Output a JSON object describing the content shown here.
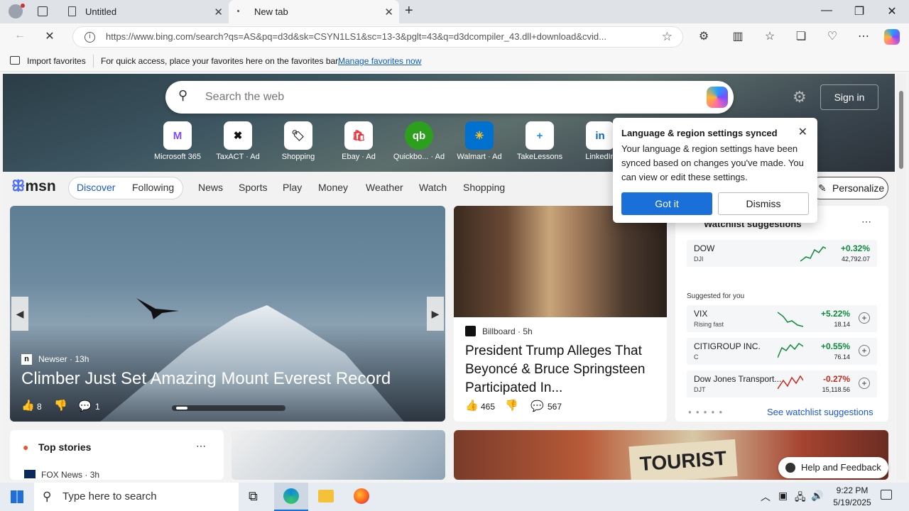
{
  "browser": {
    "tabs": [
      {
        "label": "Untitled"
      },
      {
        "label": "New tab"
      }
    ],
    "url": "https://www.bing.com/search?qs=AS&pq=d3d&sk=CSYN1LS1&sc=13-3&pglt=43&q=d3dcompiler_43.dll+download&cvid...",
    "favorites_bar": {
      "import": "Import favorites",
      "message": "For quick access, place your favorites here on the favorites bar.",
      "manage_link": "Manage favorites now"
    }
  },
  "hero": {
    "search_placeholder": "Search the web",
    "sign_in": "Sign in",
    "tiles": [
      {
        "label": "Microsoft 365",
        "icon": "M"
      },
      {
        "label": "TaxACT · Ad",
        "icon": "✖"
      },
      {
        "label": "Shopping",
        "icon": "🏷"
      },
      {
        "label": "Ebay · Ad",
        "icon": "🛍"
      },
      {
        "label": "Quickbo... · Ad",
        "icon": "qb"
      },
      {
        "label": "Walmart · Ad",
        "icon": "✳"
      },
      {
        "label": "TakeLessons",
        "icon": "+"
      },
      {
        "label": "LinkedIn",
        "icon": "in"
      }
    ]
  },
  "msn": {
    "logo": "msn",
    "nav": [
      "Discover",
      "Following",
      "News",
      "Sports",
      "Play",
      "Money",
      "Weather",
      "Watch",
      "Shopping"
    ],
    "personalize": "Personalize"
  },
  "hero_card": {
    "source": "Newser",
    "time": "13h",
    "title": "Climber Just Set Amazing Mount Everest Record",
    "likes": "8",
    "comments": "1"
  },
  "news_card": {
    "source": "Billboard",
    "time": "5h",
    "title": "President Trump Alleges That Beyoncé & Bruce Springsteen Participated In...",
    "likes": "465",
    "comments": "567"
  },
  "watchlist": {
    "title": "Watchlist suggestions",
    "suggested_label": "Suggested for you",
    "see_more": "See watchlist suggestions",
    "stocks": [
      {
        "name": "DOW",
        "symbol": "DJI",
        "change": "+0.32%",
        "price": "42,792.07",
        "dir": "up"
      },
      {
        "name": "VIX",
        "symbol": "Rising fast",
        "change": "+5.22%",
        "price": "18.14",
        "dir": "up"
      },
      {
        "name": "CITIGROUP INC.",
        "symbol": "C",
        "change": "+0.55%",
        "price": "76.14",
        "dir": "up"
      },
      {
        "name": "Dow Jones Transport...",
        "symbol": "DJT",
        "change": "-0.27%",
        "price": "15,118.56",
        "dir": "down"
      }
    ]
  },
  "popup": {
    "title": "Language & region settings synced",
    "body": "Your language & region settings have been synced based on changes you've made. You can view or edit these settings.",
    "got_it": "Got it",
    "dismiss": "Dismiss"
  },
  "top_stories": {
    "title": "Top stories",
    "source": "FOX News",
    "time": "3h"
  },
  "help": "Help and Feedback",
  "taskbar": {
    "search_placeholder": "Type here to search",
    "time": "9:22 PM",
    "date": "5/19/2025"
  }
}
